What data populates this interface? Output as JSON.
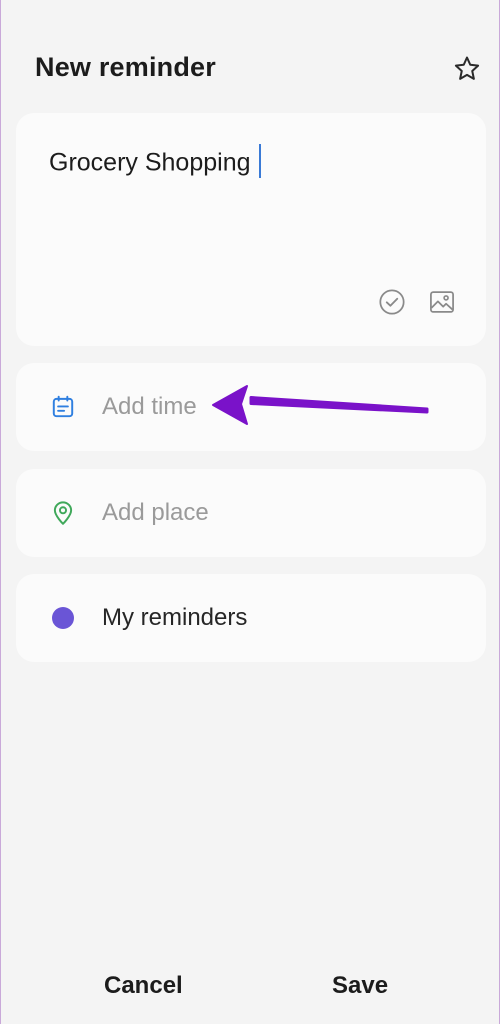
{
  "header": {
    "title": "New reminder",
    "favorite_icon": "star-outline-icon"
  },
  "title_card": {
    "value": "Grocery Shopping",
    "complete_icon": "check-circle-icon",
    "image_icon": "image-icon"
  },
  "rows": {
    "time": {
      "label": "Add time",
      "icon": "calendar-icon",
      "icon_color": "#2f7fe0"
    },
    "place": {
      "label": "Add place",
      "icon": "location-pin-icon",
      "icon_color": "#3fa85a"
    },
    "category": {
      "label": "My reminders",
      "icon": "category-dot",
      "icon_color": "#6a55d6"
    }
  },
  "annotation": {
    "arrow_color": "#7a12c9"
  },
  "footer": {
    "cancel_label": "Cancel",
    "save_label": "Save"
  }
}
